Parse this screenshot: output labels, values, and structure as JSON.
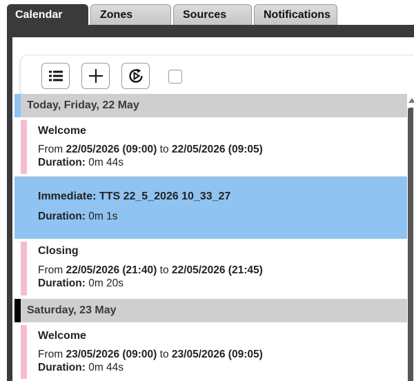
{
  "tabs": [
    {
      "label": "Calendar",
      "active": true
    },
    {
      "label": "Zones",
      "active": false
    },
    {
      "label": "Sources",
      "active": false
    },
    {
      "label": "Notifications",
      "active": false
    }
  ],
  "toolbar": {
    "buttons": [
      {
        "icon": "list-icon"
      },
      {
        "icon": "plus-icon"
      },
      {
        "icon": "replay-icon"
      }
    ],
    "checkbox_checked": false
  },
  "days": [
    {
      "header": "Today, Friday, 22 May",
      "marker_color": "#8fc3f1",
      "events": [
        {
          "title": "Welcome",
          "from_label": "From",
          "from": "22/05/2026 (09:00)",
          "to_label": "to",
          "to": "22/05/2026 (09:05)",
          "duration_label": "Duration:",
          "duration": "0m 44s",
          "stripe_color": "#f5bcd0"
        },
        {
          "title": "Immediate: TTS 22_5_2026 10_33_27",
          "duration_label": "Duration:",
          "duration": "0m 1s",
          "selected": true,
          "stripe_color": "#8fc3f1"
        },
        {
          "title": "Closing",
          "from_label": "From",
          "from": "22/05/2026 (21:40)",
          "to_label": "to",
          "to": "22/05/2026 (21:45)",
          "duration_label": "Duration:",
          "duration": "0m 20s",
          "stripe_color": "#f5bcd0"
        }
      ]
    },
    {
      "header": "Saturday, 23 May",
      "marker_color": "#000000",
      "events": [
        {
          "title": "Welcome",
          "from_label": "From",
          "from": "23/05/2026 (09:00)",
          "to_label": "to",
          "to": "23/05/2026 (09:05)",
          "duration_label": "Duration:",
          "duration": "0m 44s",
          "stripe_color": "#f5bcd0"
        }
      ]
    }
  ],
  "colors": {
    "frame": "#3a3a3a",
    "header_bg": "#cfcfcf",
    "selected_bg": "#8fc3f1",
    "stripe_pink": "#f5bcd0"
  }
}
